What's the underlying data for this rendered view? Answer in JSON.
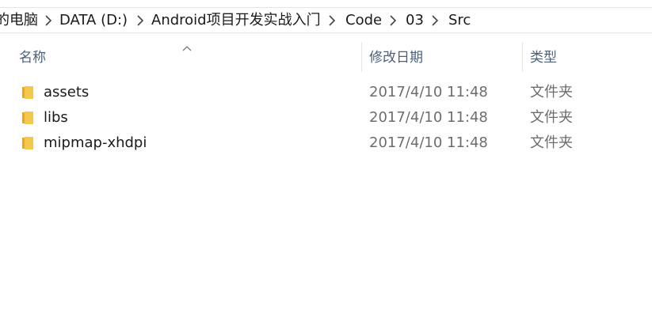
{
  "breadcrumb": {
    "segments": [
      {
        "label": "的电脑"
      },
      {
        "label": "DATA (D:)"
      },
      {
        "label": "Android项目开发实战入门"
      },
      {
        "label": "Code"
      },
      {
        "label": "03"
      },
      {
        "label": "Src"
      }
    ]
  },
  "columns": {
    "name": "名称",
    "modified": "修改日期",
    "type": "类型",
    "sorted_by": "name",
    "sort_direction": "ascending"
  },
  "files": [
    {
      "name": "assets",
      "modified": "2017/4/10 11:48",
      "type": "文件夹",
      "icon": "folder-icon"
    },
    {
      "name": "libs",
      "modified": "2017/4/10 11:48",
      "type": "文件夹",
      "icon": "folder-icon"
    },
    {
      "name": "mipmap-xhdpi",
      "modified": "2017/4/10 11:48",
      "type": "文件夹",
      "icon": "folder-icon"
    }
  ],
  "colors": {
    "folder": "#f2c94c",
    "folder_dark": "#e0aa2a",
    "header_text": "#4c607a",
    "secondary_text": "#6d6d6d"
  }
}
